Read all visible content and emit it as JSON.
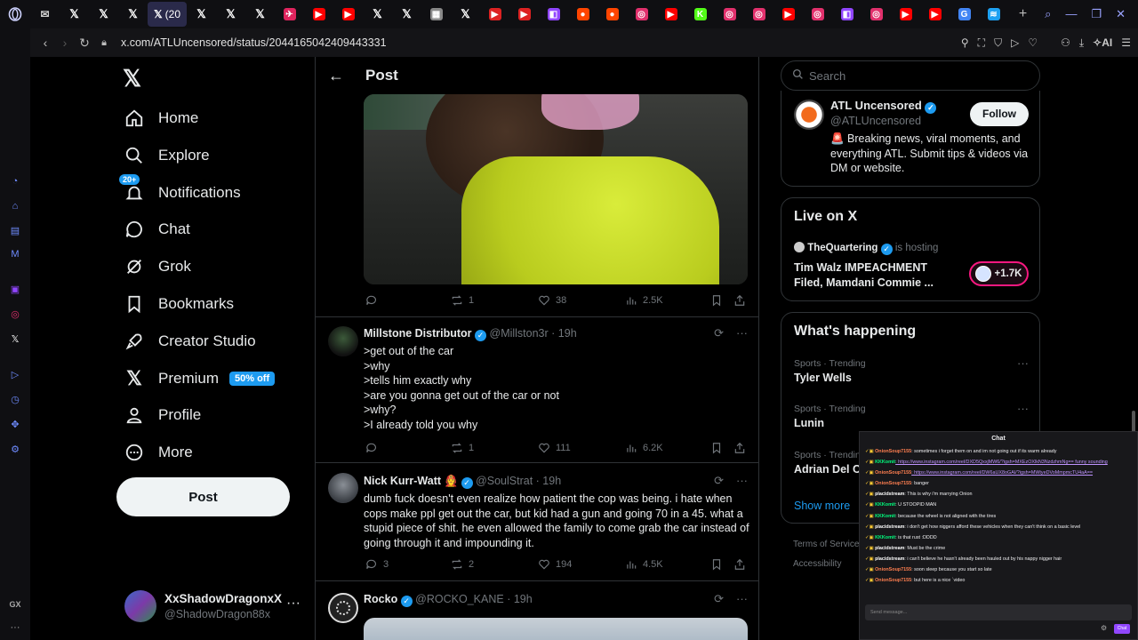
{
  "browser": {
    "url": "x.com/ATLUncensored/status/2044165042409443331",
    "active_tab_label": "(20",
    "tabs": [
      {
        "icon": "mail-icon",
        "color": "#cccccc"
      },
      {
        "icon": "x-icon",
        "color": "#ffffff"
      },
      {
        "icon": "x-icon",
        "color": "#ffffff"
      },
      {
        "icon": "x-icon",
        "color": "#ffffff"
      },
      {
        "icon": "x-icon",
        "color": "#ffffff"
      },
      {
        "icon": "x-icon",
        "color": "#ffffff"
      },
      {
        "icon": "x-icon",
        "color": "#ffffff"
      },
      {
        "icon": "jet-icon",
        "color": "#e0245e"
      },
      {
        "icon": "youtube-icon",
        "color": "#ff0000"
      },
      {
        "icon": "youtube-icon",
        "color": "#ff0000"
      },
      {
        "icon": "x-icon",
        "color": "#ffffff"
      },
      {
        "icon": "x-icon",
        "color": "#ffffff"
      },
      {
        "icon": "news-icon",
        "color": "#888888"
      },
      {
        "icon": "x-icon",
        "color": "#ffffff"
      },
      {
        "icon": "play-icon",
        "color": "#dd2222"
      },
      {
        "icon": "play-icon",
        "color": "#dd2222"
      },
      {
        "icon": "twitch-icon",
        "color": "#9146ff"
      },
      {
        "icon": "reddit-icon",
        "color": "#ff4500"
      },
      {
        "icon": "reddit-icon",
        "color": "#ff4500"
      },
      {
        "icon": "instagram-icon",
        "color": "#e1306c"
      },
      {
        "icon": "youtube-icon",
        "color": "#ff0000"
      },
      {
        "icon": "kick-icon",
        "color": "#53fc18"
      },
      {
        "icon": "instagram-icon",
        "color": "#e1306c"
      },
      {
        "icon": "instagram-icon",
        "color": "#e1306c"
      },
      {
        "icon": "youtube-icon",
        "color": "#ff0000"
      },
      {
        "icon": "instagram-icon",
        "color": "#e1306c"
      },
      {
        "icon": "twitch-icon",
        "color": "#9146ff"
      },
      {
        "icon": "instagram-icon",
        "color": "#e1306c"
      },
      {
        "icon": "youtube-icon",
        "color": "#ff0000"
      },
      {
        "icon": "youtube-icon",
        "color": "#ff0000"
      },
      {
        "icon": "google-icon",
        "color": "#4285f4"
      },
      {
        "icon": "app-icon",
        "color": "#1da1f2"
      }
    ],
    "toolbar_right_label": "AI"
  },
  "nav": {
    "home": "Home",
    "explore": "Explore",
    "notifications": "Notifications",
    "notifications_badge": "20+",
    "chat": "Chat",
    "grok": "Grok",
    "bookmarks": "Bookmarks",
    "creator_studio": "Creator Studio",
    "premium": "Premium",
    "premium_badge": "50% off",
    "profile": "Profile",
    "more": "More",
    "post_button": "Post",
    "account_name": "XxShadowDragonxX",
    "account_handle": "@ShadowDragon88x"
  },
  "feed": {
    "header_title": "Post",
    "main_post_actions": {
      "replies": "",
      "reposts": "1",
      "likes": "38",
      "views": "2.5K"
    },
    "replies": [
      {
        "name": "Millstone Distributor",
        "handle": "@Millston3r",
        "time": "· 19h",
        "lines": [
          ">get out of the car",
          ">why",
          ">tells him exactly why",
          ">are you gonna get out of the car or not",
          ">why?",
          ">I already told you why"
        ],
        "replies": "",
        "reposts": "1",
        "likes": "111",
        "views": "6.2K"
      },
      {
        "name": "Nick Kurr-Watt 🧑‍🚒",
        "handle": "@SoulStrat",
        "time": "· 19h",
        "text": "dumb fuck doesn't even realize how patient the cop was being. i hate when cops make ppl get out the car, but kid had a gun and going 70 in a 45. what a stupid piece of shit. he even allowed the family to come grab the car instead of going through it and impounding it.",
        "replies": "3",
        "reposts": "2",
        "likes": "194",
        "views": "4.5K"
      },
      {
        "name": "Rocko",
        "handle": "@ROCKO_KANE",
        "time": "· 19h"
      }
    ]
  },
  "sidebar": {
    "search_placeholder": "Search",
    "profile_card": {
      "name": "ATL Uncensored",
      "handle": "@ATLUncensored",
      "bio": "🚨 Breaking news, viral moments, and everything ATL. Submit tips & videos via DM or website.",
      "follow": "Follow"
    },
    "live": {
      "title": "Live on X",
      "host": "TheQuartering",
      "hosting": "is hosting",
      "stream_title": "Tim Walz IMPEACHMENT Filed, Mamdani Commie ...",
      "listeners": "+1.7K"
    },
    "happening": {
      "title": "What's happening",
      "trends": [
        {
          "category": "Sports · Trending",
          "name": "Tyler Wells"
        },
        {
          "category": "Sports · Trending",
          "name": "Lunin"
        },
        {
          "category": "Sports · Trending",
          "name": "Adrian Del C"
        }
      ],
      "show_more": "Show more"
    },
    "footer_1": "Terms of Service",
    "footer_2": "Accessibility"
  },
  "chat": {
    "title": "Chat",
    "input_placeholder": "Send message...",
    "send_label": "Chat",
    "messages": [
      {
        "user": "OnionSoup7155",
        "color": "#ff7f50",
        "text": ": sometimes i forget them on and im not going out if its warm already"
      },
      {
        "user": "KKKomit",
        "color": "#00ff7f",
        "text": ": https://www.instagram.com/reel/DXD5QxxjMW6/?igsh=MXEzOXlkN3NzdzhmNg== funny sounding",
        "link": true
      },
      {
        "user": "OnionSoup7155",
        "color": "#ff7f50",
        "text": ": https://www.instagram.com/reel/DW6aUX8oGAI/?igsh=MWtyeDVoMmpmcTU4aA==",
        "link": true
      },
      {
        "user": "OnionSoup7155",
        "color": "#ff7f50",
        "text": ": banger"
      },
      {
        "user": "placidstream",
        "color": "#ffffff",
        "text": ": This is why i'm marrying Onion"
      },
      {
        "user": "KKKomit",
        "color": "#00ff7f",
        "text": ": U STOOPID MAN"
      },
      {
        "user": "KKKomit",
        "color": "#00ff7f",
        "text": ": because the wheel is not aligned with the tires"
      },
      {
        "user": "placidstream",
        "color": "#ffffff",
        "text": ": i don't get how niggers afford these vehicles when they can't think on a basic level"
      },
      {
        "user": "KKKomit",
        "color": "#00ff7f",
        "text": ": is that rust :DDDD"
      },
      {
        "user": "placidstream",
        "color": "#ffffff",
        "text": ": Must be the crime"
      },
      {
        "user": "placidstream",
        "color": "#ffffff",
        "text": ": i can't believe he hasn't already been hauled out by his nappy nigger hair"
      },
      {
        "user": "OnionSoup7155",
        "color": "#ff7f50",
        "text": ": soon sleep because you start so late"
      },
      {
        "user": "OnionSoup7155",
        "color": "#ff7f50",
        "text": ": but here is a nice `video"
      }
    ]
  },
  "colors": {
    "accent": "#1d9bf0",
    "background": "#000000",
    "border": "#2f3336",
    "muted": "#71767b",
    "twitch_purple": "#9147ff"
  }
}
